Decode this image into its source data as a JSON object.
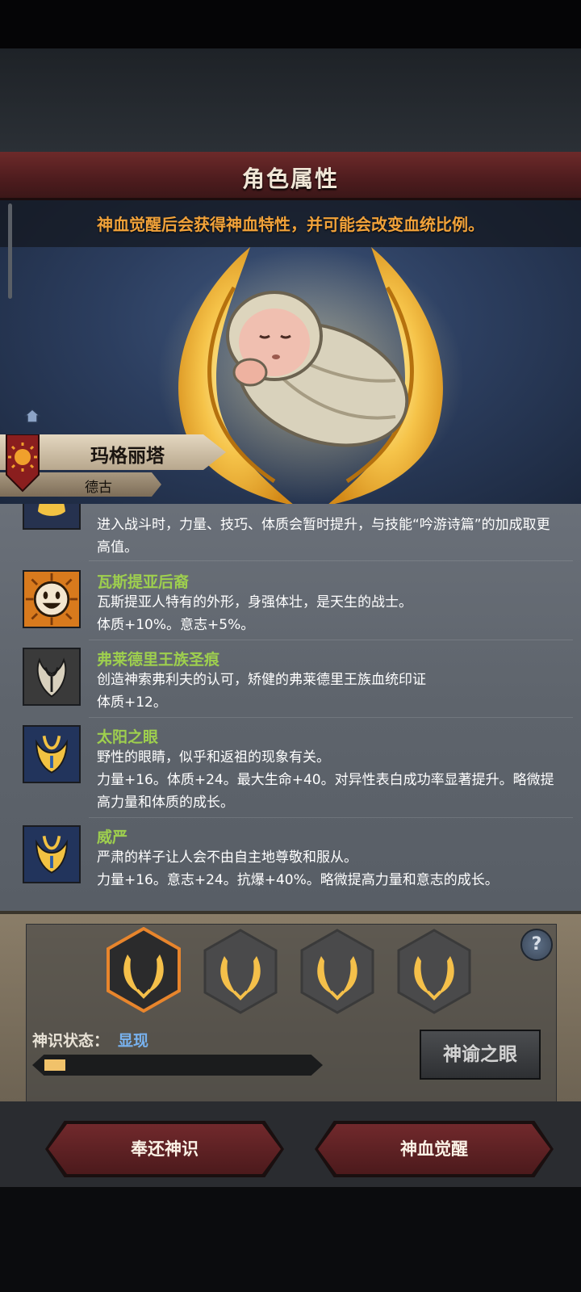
{
  "screen": {
    "title": "角色属性",
    "notice": "神血觉醒后会获得神血特性，并可能会改变血统比例。"
  },
  "character": {
    "name": "玛格丽塔",
    "origin": "德古"
  },
  "traits": [
    {
      "name": "",
      "desc": "进入战斗时，力量、技巧、体质会暂时提升，与技能“吟游诗篇”的加成取更高值。",
      "icon": "golden-blood-icon"
    },
    {
      "name": "瓦斯提亚后裔",
      "desc": "瓦斯提亚人特有的外形，身强体壮，是天生的战士。",
      "stats": "体质+10%。意志+5%。",
      "icon": "smiling-face-icon"
    },
    {
      "name": "弗莱德里王族圣痕",
      "desc": "创造神索弗利夫的认可，矫健的弗莱德里王族血统印证",
      "stats": "体质+12。",
      "icon": "stigmata-icon"
    },
    {
      "name": "太阳之眼",
      "desc": "野性的眼睛，似乎和返祖的现象有关。",
      "stats": "力量+16。体质+24。最大生命+40。对异性表白成功率显著提升。略微提高力量和体质的成长。",
      "icon": "sun-eye-icon"
    },
    {
      "name": "威严",
      "desc": "严肃的样子让人会不由自主地尊敬和服从。",
      "stats": "力量+16。意志+24。抗爆+40%。略微提高力量和意志的成长。",
      "icon": "majesty-icon"
    }
  ],
  "awakening": {
    "slots": [
      "divine-wings-icon",
      "divine-wings-icon",
      "divine-wings-icon",
      "divine-wings-icon"
    ],
    "status_label": "神识状态：",
    "status_value": "显现",
    "progress": 0.08,
    "oracle_button": "神谕之眼",
    "help_label": "?"
  },
  "actions": {
    "return_button": "奉还神识",
    "awaken_button": "神血觉醒"
  },
  "colors": {
    "title_red": "#6d2a2a",
    "notice_orange": "#f1a23a",
    "trait_name_green": "#9ecf4e",
    "status_blue": "#78b2ef",
    "progress_fill": "#f1c26a",
    "gold": "#f5c04a"
  }
}
